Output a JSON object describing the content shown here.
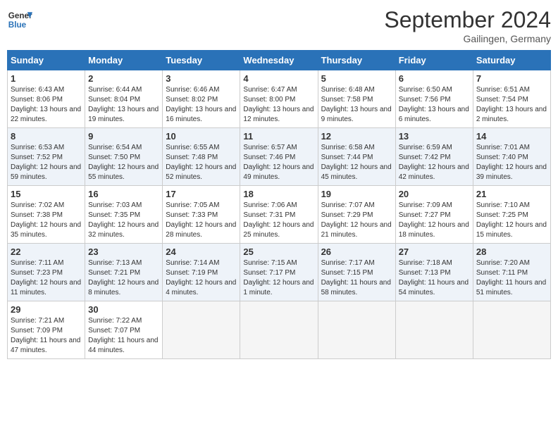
{
  "header": {
    "logo_line1": "General",
    "logo_line2": "Blue",
    "month_year": "September 2024",
    "location": "Gailingen, Germany"
  },
  "days_of_week": [
    "Sunday",
    "Monday",
    "Tuesday",
    "Wednesday",
    "Thursday",
    "Friday",
    "Saturday"
  ],
  "weeks": [
    [
      {
        "day": "1",
        "sunrise": "6:43 AM",
        "sunset": "8:06 PM",
        "daylight": "13 hours and 22 minutes."
      },
      {
        "day": "2",
        "sunrise": "6:44 AM",
        "sunset": "8:04 PM",
        "daylight": "13 hours and 19 minutes."
      },
      {
        "day": "3",
        "sunrise": "6:46 AM",
        "sunset": "8:02 PM",
        "daylight": "13 hours and 16 minutes."
      },
      {
        "day": "4",
        "sunrise": "6:47 AM",
        "sunset": "8:00 PM",
        "daylight": "13 hours and 12 minutes."
      },
      {
        "day": "5",
        "sunrise": "6:48 AM",
        "sunset": "7:58 PM",
        "daylight": "13 hours and 9 minutes."
      },
      {
        "day": "6",
        "sunrise": "6:50 AM",
        "sunset": "7:56 PM",
        "daylight": "13 hours and 6 minutes."
      },
      {
        "day": "7",
        "sunrise": "6:51 AM",
        "sunset": "7:54 PM",
        "daylight": "13 hours and 2 minutes."
      }
    ],
    [
      {
        "day": "8",
        "sunrise": "6:53 AM",
        "sunset": "7:52 PM",
        "daylight": "12 hours and 59 minutes."
      },
      {
        "day": "9",
        "sunrise": "6:54 AM",
        "sunset": "7:50 PM",
        "daylight": "12 hours and 55 minutes."
      },
      {
        "day": "10",
        "sunrise": "6:55 AM",
        "sunset": "7:48 PM",
        "daylight": "12 hours and 52 minutes."
      },
      {
        "day": "11",
        "sunrise": "6:57 AM",
        "sunset": "7:46 PM",
        "daylight": "12 hours and 49 minutes."
      },
      {
        "day": "12",
        "sunrise": "6:58 AM",
        "sunset": "7:44 PM",
        "daylight": "12 hours and 45 minutes."
      },
      {
        "day": "13",
        "sunrise": "6:59 AM",
        "sunset": "7:42 PM",
        "daylight": "12 hours and 42 minutes."
      },
      {
        "day": "14",
        "sunrise": "7:01 AM",
        "sunset": "7:40 PM",
        "daylight": "12 hours and 39 minutes."
      }
    ],
    [
      {
        "day": "15",
        "sunrise": "7:02 AM",
        "sunset": "7:38 PM",
        "daylight": "12 hours and 35 minutes."
      },
      {
        "day": "16",
        "sunrise": "7:03 AM",
        "sunset": "7:35 PM",
        "daylight": "12 hours and 32 minutes."
      },
      {
        "day": "17",
        "sunrise": "7:05 AM",
        "sunset": "7:33 PM",
        "daylight": "12 hours and 28 minutes."
      },
      {
        "day": "18",
        "sunrise": "7:06 AM",
        "sunset": "7:31 PM",
        "daylight": "12 hours and 25 minutes."
      },
      {
        "day": "19",
        "sunrise": "7:07 AM",
        "sunset": "7:29 PM",
        "daylight": "12 hours and 21 minutes."
      },
      {
        "day": "20",
        "sunrise": "7:09 AM",
        "sunset": "7:27 PM",
        "daylight": "12 hours and 18 minutes."
      },
      {
        "day": "21",
        "sunrise": "7:10 AM",
        "sunset": "7:25 PM",
        "daylight": "12 hours and 15 minutes."
      }
    ],
    [
      {
        "day": "22",
        "sunrise": "7:11 AM",
        "sunset": "7:23 PM",
        "daylight": "12 hours and 11 minutes."
      },
      {
        "day": "23",
        "sunrise": "7:13 AM",
        "sunset": "7:21 PM",
        "daylight": "12 hours and 8 minutes."
      },
      {
        "day": "24",
        "sunrise": "7:14 AM",
        "sunset": "7:19 PM",
        "daylight": "12 hours and 4 minutes."
      },
      {
        "day": "25",
        "sunrise": "7:15 AM",
        "sunset": "7:17 PM",
        "daylight": "12 hours and 1 minute."
      },
      {
        "day": "26",
        "sunrise": "7:17 AM",
        "sunset": "7:15 PM",
        "daylight": "11 hours and 58 minutes."
      },
      {
        "day": "27",
        "sunrise": "7:18 AM",
        "sunset": "7:13 PM",
        "daylight": "11 hours and 54 minutes."
      },
      {
        "day": "28",
        "sunrise": "7:20 AM",
        "sunset": "7:11 PM",
        "daylight": "11 hours and 51 minutes."
      }
    ],
    [
      {
        "day": "29",
        "sunrise": "7:21 AM",
        "sunset": "7:09 PM",
        "daylight": "11 hours and 47 minutes."
      },
      {
        "day": "30",
        "sunrise": "7:22 AM",
        "sunset": "7:07 PM",
        "daylight": "11 hours and 44 minutes."
      },
      null,
      null,
      null,
      null,
      null
    ]
  ]
}
